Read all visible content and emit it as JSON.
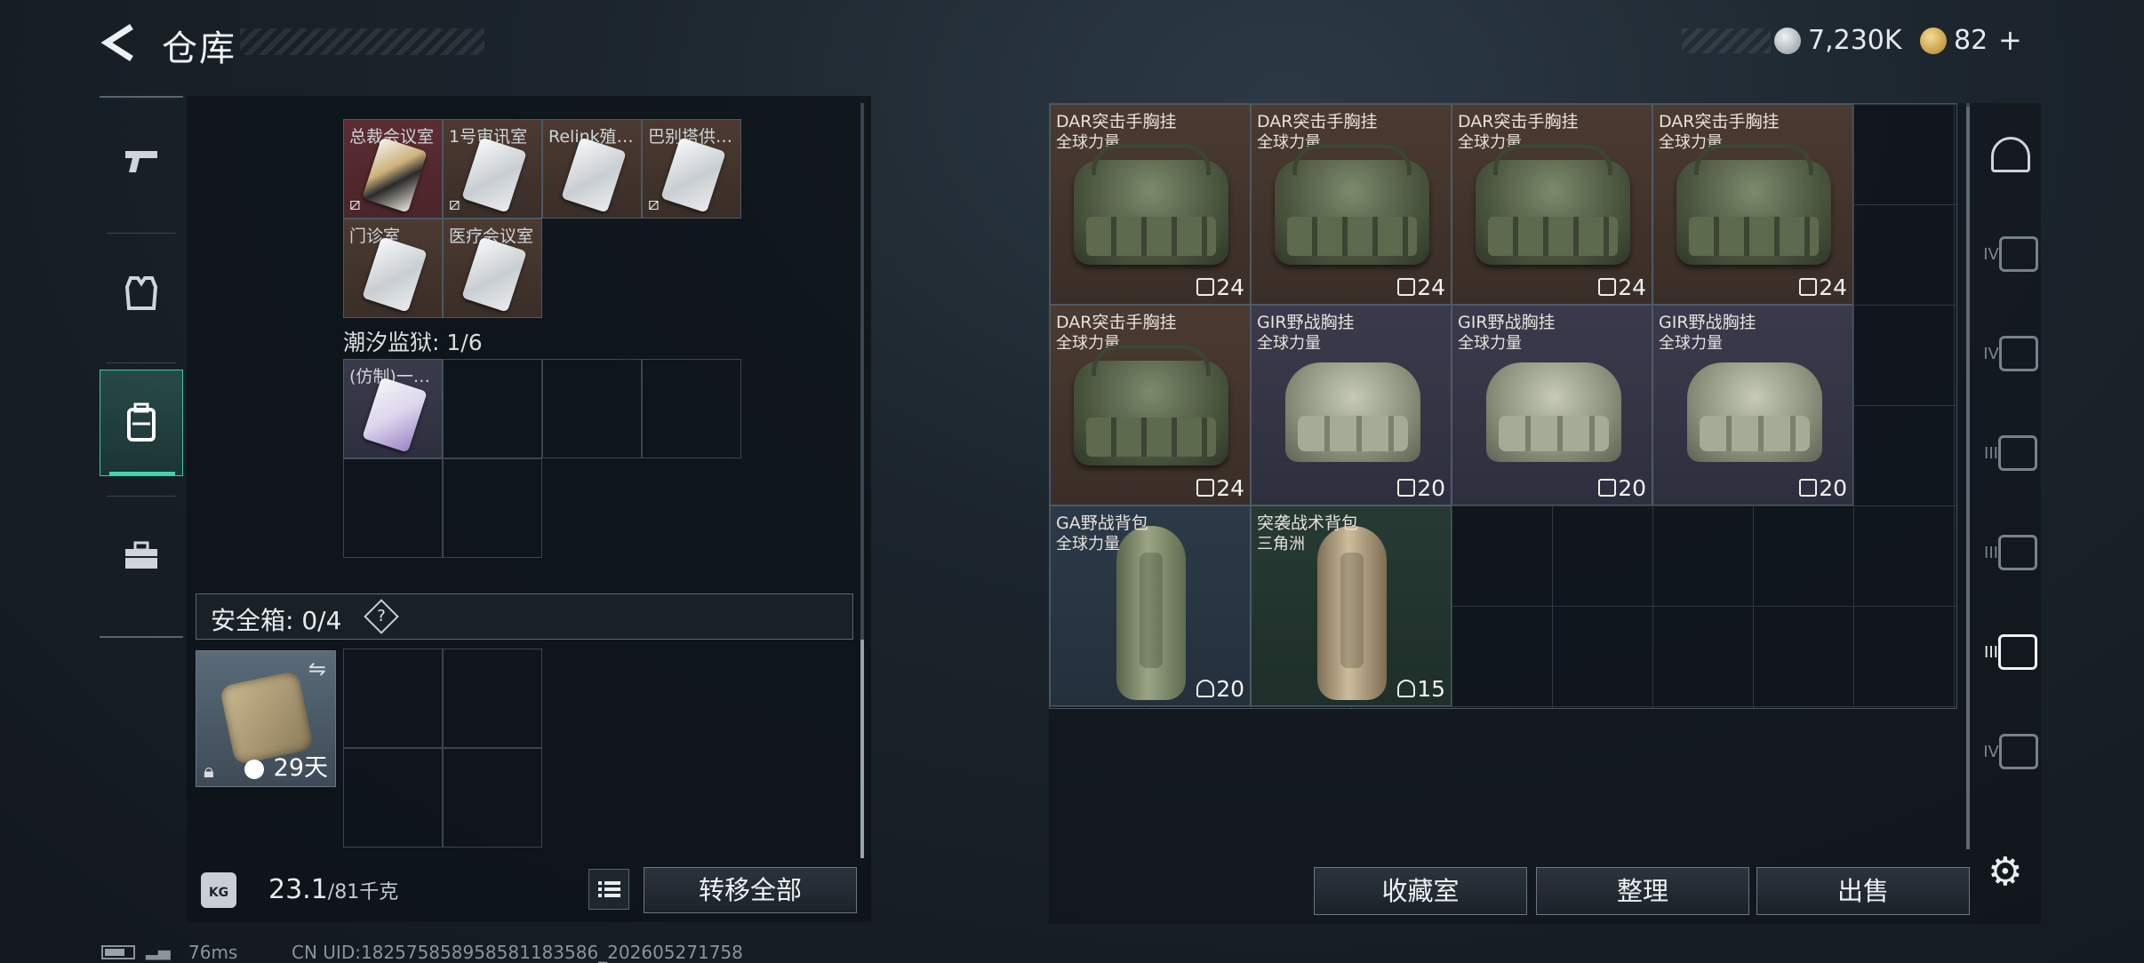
{
  "header": {
    "title": "仓库",
    "back_icon": "chevron-left-icon"
  },
  "currency": {
    "silver": "7,230K",
    "gold": "82",
    "add_label": "+"
  },
  "left_tabs": [
    {
      "icon": "pistol-icon"
    },
    {
      "icon": "armor-vest-icon"
    },
    {
      "icon": "backpack-icon",
      "active": true
    },
    {
      "icon": "toolbox-icon"
    }
  ],
  "keys_section": {
    "items": [
      {
        "name": "总裁会议室",
        "style": "gold",
        "locked": true
      },
      {
        "name": "1号审讯室",
        "style": "silver",
        "locked": true
      },
      {
        "name": "Relink殖…",
        "style": "silver",
        "locked": false
      },
      {
        "name": "巴别塔供…",
        "style": "silver",
        "locked": true
      },
      {
        "name": "门诊室",
        "style": "silver",
        "locked": false
      },
      {
        "name": "医疗会议室",
        "style": "silver",
        "locked": false
      }
    ]
  },
  "prison_section": {
    "label": "潮汐监狱: 1/6",
    "item": {
      "name": "(仿制)一…"
    }
  },
  "safe_box": {
    "label": "安全箱: 0/4",
    "help": "?",
    "days": "29天"
  },
  "weight": {
    "current": "23.1",
    "max": "/81千克",
    "icon_text": "KG"
  },
  "buttons": {
    "transfer_all": "转移全部",
    "collection": "收藏室",
    "sort": "整理",
    "sell": "出售"
  },
  "storage_items": [
    {
      "name": "DAR突击手胸挂",
      "sub": "全球力量",
      "cap": "24",
      "style": "brown",
      "kind": "duffel"
    },
    {
      "name": "DAR突击手胸挂",
      "sub": "全球力量",
      "cap": "24",
      "style": "brown",
      "kind": "duffel"
    },
    {
      "name": "DAR突击手胸挂",
      "sub": "全球力量",
      "cap": "24",
      "style": "brown",
      "kind": "duffel"
    },
    {
      "name": "DAR突击手胸挂",
      "sub": "全球力量",
      "cap": "24",
      "style": "brown",
      "kind": "duffel"
    },
    {
      "name": "DAR突击手胸挂",
      "sub": "全球力量",
      "cap": "24",
      "style": "brown",
      "kind": "duffel"
    },
    {
      "name": "GIR野战胸挂",
      "sub": "全球力量",
      "cap": "20",
      "style": "purple",
      "kind": "vest"
    },
    {
      "name": "GIR野战胸挂",
      "sub": "全球力量",
      "cap": "20",
      "style": "purple",
      "kind": "vest"
    },
    {
      "name": "GIR野战胸挂",
      "sub": "全球力量",
      "cap": "20",
      "style": "purple",
      "kind": "vest"
    },
    {
      "name": "GA野战背包",
      "sub": "全球力量",
      "cap": "20",
      "style": "blue",
      "kind": "olive"
    },
    {
      "name": "突袭战术背包",
      "sub": "三角洲",
      "cap": "15",
      "style": "green",
      "kind": "tan"
    }
  ],
  "right_tabs": [
    {
      "label": "",
      "icon": "helmet-icon"
    },
    {
      "label": "IV",
      "icon": "storage-tier4-icon"
    },
    {
      "label": "IV",
      "icon": "storage-tier4-icon"
    },
    {
      "label": "III",
      "icon": "storage-tier3-icon"
    },
    {
      "label": "III",
      "icon": "storage-tier3-icon"
    },
    {
      "label": "III",
      "icon": "storage-tier3-locked-icon",
      "active": true
    },
    {
      "label": "IV",
      "icon": "storage-add-icon"
    }
  ],
  "status": {
    "ping": "76ms",
    "uid": "CN UID:1825758589585811835​86_202605271758"
  }
}
